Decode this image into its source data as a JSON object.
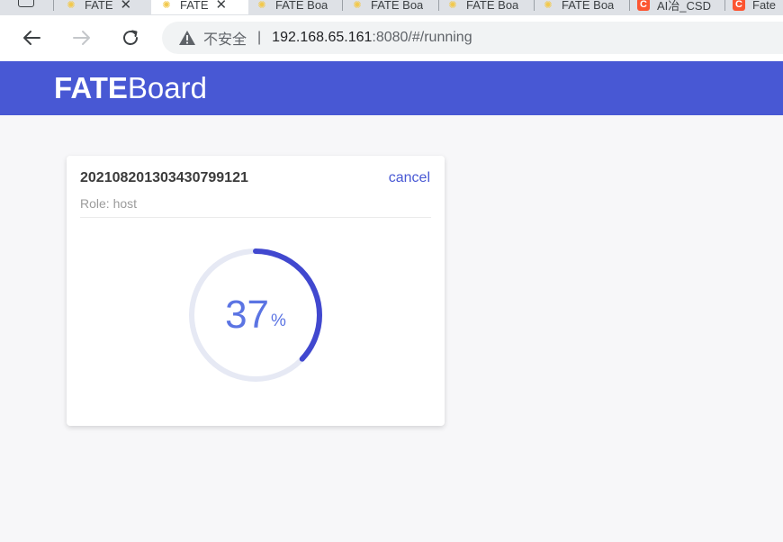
{
  "browser": {
    "tabs": [
      {
        "label": "FATE",
        "icon": "fateboard-favicon-icon",
        "active": false,
        "closable": true
      },
      {
        "label": "FATE",
        "icon": "fateboard-favicon-icon",
        "active": true,
        "closable": true
      },
      {
        "label": "FATE Boa",
        "icon": "fateboard-favicon-icon",
        "active": false
      },
      {
        "label": "FATE Boa",
        "icon": "fateboard-favicon-icon",
        "active": false
      },
      {
        "label": "FATE Boa",
        "icon": "fateboard-favicon-icon",
        "active": false
      },
      {
        "label": "FATE Boa",
        "icon": "fateboard-favicon-icon",
        "active": false
      },
      {
        "label": "AI冶_CSD",
        "icon": "csdn-icon",
        "active": false
      },
      {
        "label": "Fate",
        "icon": "csdn-icon",
        "active": false
      }
    ],
    "csdn_badge": "C",
    "close_glyph": "✕",
    "address": {
      "security_label": "不安全",
      "separator": "|",
      "host": "192.168.65.161",
      "path": ":8080/#/running"
    }
  },
  "app": {
    "brand_bold": "FATE",
    "brand_regular": "Board",
    "header_color": "#4858d4"
  },
  "job": {
    "id": "20210820130343079912​1",
    "cancel_label": "cancel",
    "role_label": "Role: host",
    "progress": 37,
    "progress_unit": "%",
    "progress_color": "#4148cf",
    "track_color": "#e6e9f4"
  }
}
